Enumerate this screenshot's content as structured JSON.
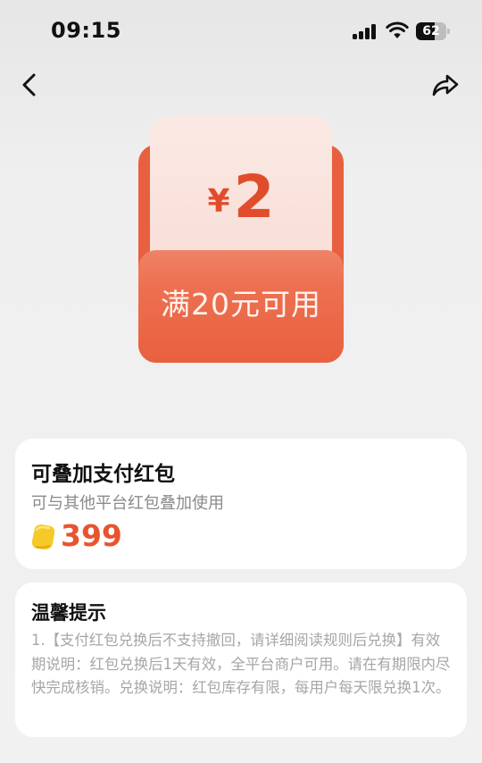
{
  "status_bar": {
    "time": "09:15",
    "battery": "62",
    "battery_level": 0.62
  },
  "nav": {
    "back_icon": "chevron-left-icon",
    "share_icon": "share-icon"
  },
  "red_packet": {
    "currency_symbol": "¥",
    "amount": "2",
    "condition": "满20元可用",
    "colors": {
      "accent": "#e8603f",
      "amount": "#e14d2c"
    }
  },
  "product": {
    "title": "可叠加支付红包",
    "subtitle": "可与其他平台红包叠加使用",
    "coin_icon": "gold-coin-icon",
    "price": "399",
    "price_color": "#e8542f"
  },
  "tips": {
    "title": "温馨提示",
    "body": "1.【支付红包兑换后不支持撤回，请详细阅读规则后兑换】有效期说明：红包兑换后1天有效，全平台商户可用。请在有期限内尽快完成核销。兑换说明：红包库存有限，每用户每天限兑换1次。"
  }
}
